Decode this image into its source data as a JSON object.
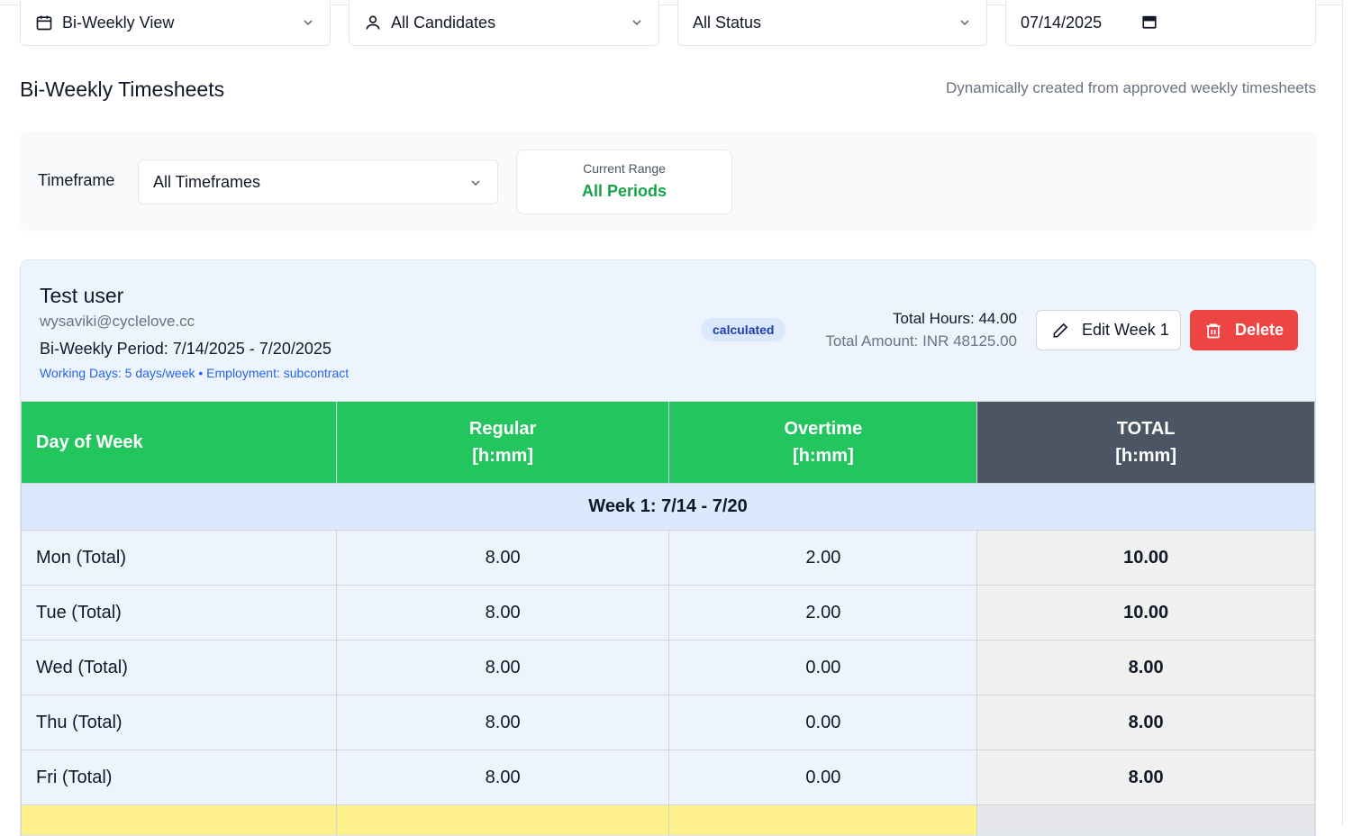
{
  "filters": {
    "view": {
      "label": "Bi-Weekly View",
      "icon": "calendar-icon"
    },
    "candidates": {
      "label": "All Candidates",
      "icon": "user-icon"
    },
    "status": {
      "label": "All Status"
    },
    "date": {
      "value": "07/14/2025"
    }
  },
  "header": {
    "title": "Bi-Weekly Timesheets",
    "subtitle": "Dynamically created from approved weekly timesheets"
  },
  "timeframe": {
    "label": "Timeframe",
    "selected": "All Timeframes",
    "range_label": "Current Range",
    "range_value": "All Periods"
  },
  "card": {
    "name": "Test user",
    "email": "wysaviki@cyclelove.cc",
    "period": "Bi-Weekly Period: 7/14/2025 - 7/20/2025",
    "meta": "Working Days: 5 days/week • Employment: subcontract",
    "status_badge": "calculated",
    "total_hours": "Total Hours: 44.00",
    "total_amount": "Total Amount: INR 48125.00",
    "edit_label": "Edit Week 1",
    "delete_label": "Delete"
  },
  "table": {
    "headers": {
      "day": "Day of Week",
      "regular": "Regular",
      "regular_unit": "[h:mm]",
      "overtime": "Overtime",
      "overtime_unit": "[h:mm]",
      "total": "TOTAL",
      "total_unit": "[h:mm]"
    },
    "week_label": "Week 1: 7/14 - 7/20",
    "rows": [
      {
        "day": "Mon (Total)",
        "regular": "8.00",
        "overtime": "2.00",
        "total": "10.00"
      },
      {
        "day": "Tue (Total)",
        "regular": "8.00",
        "overtime": "2.00",
        "total": "10.00"
      },
      {
        "day": "Wed (Total)",
        "regular": "8.00",
        "overtime": "0.00",
        "total": "8.00"
      },
      {
        "day": "Thu (Total)",
        "regular": "8.00",
        "overtime": "0.00",
        "total": "8.00"
      },
      {
        "day": "Fri (Total)",
        "regular": "8.00",
        "overtime": "0.00",
        "total": "8.00"
      }
    ]
  },
  "colors": {
    "accent_green": "#22c55e",
    "header_dark": "#4b5563",
    "delete_red": "#ef4444",
    "link_blue": "#2563eb"
  }
}
